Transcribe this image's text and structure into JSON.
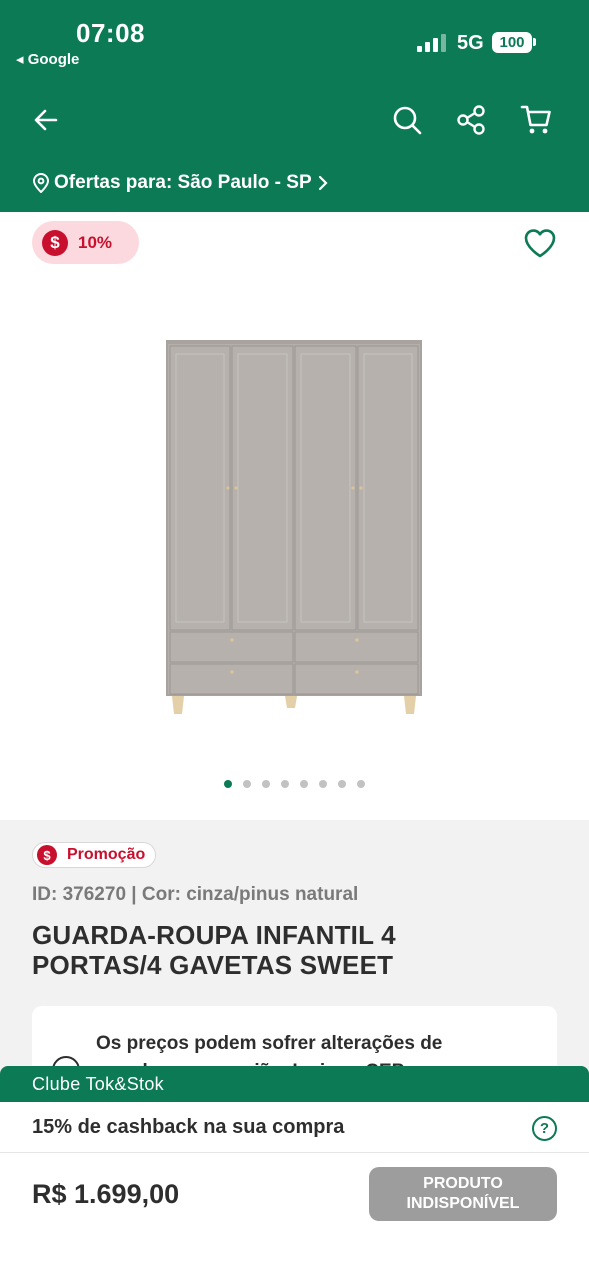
{
  "status_bar": {
    "time": "07:08",
    "back_app": "◂ Google",
    "network": "5G",
    "battery": "100"
  },
  "header": {
    "location_label": "Ofertas para: São Paulo - SP",
    "icons": [
      "arrow-left-icon",
      "search-icon",
      "share-icon",
      "cart-icon"
    ]
  },
  "product": {
    "discount_badge": "10%",
    "promo_tag": "Promoção",
    "id_line": "ID: 376270 | Cor: cinza/pinus natural",
    "title_line1": "GUARDA-ROUPA INFANTIL 4",
    "title_line2": "PORTAS/4 GAVETAS SWEET",
    "image_count": 8,
    "active_image": 1,
    "notice_line1": "Os preços podem sofrer alterações de",
    "notice_line2": "acordo com a região. Insira o CEP"
  },
  "club": {
    "title": "Clube Tok&Stok",
    "cashback": "15% de cashback na sua compra"
  },
  "footer": {
    "price": "R$ 1.699,00",
    "button_line1": "PRODUTO",
    "button_line2": "INDISPONÍVEL"
  },
  "colors": {
    "brand_green": "#0b7a55",
    "promo_red": "#c8102e",
    "disabled_gray": "#9d9d9d"
  }
}
